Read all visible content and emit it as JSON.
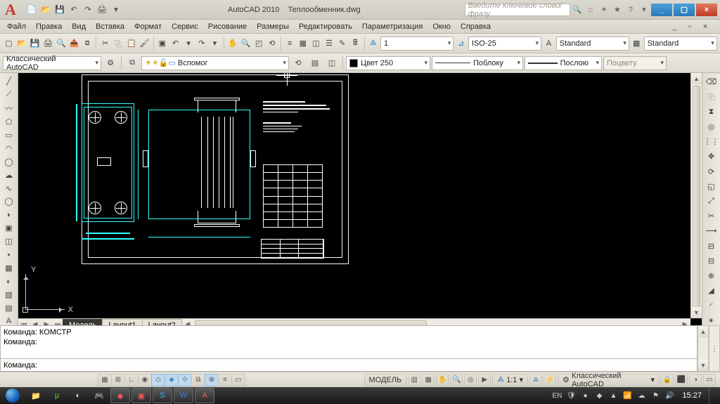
{
  "title": {
    "app": "AutoCAD 2010",
    "file": "Теплообменник.dwg",
    "search_placeholder": "Введите ключевое слово/фразу"
  },
  "menubar": [
    "Файл",
    "Правка",
    "Вид",
    "Вставка",
    "Формат",
    "Сервис",
    "Рисование",
    "Размеры",
    "Редактировать",
    "Параметризация",
    "Окно",
    "Справка"
  ],
  "workspace": {
    "value": "Классический AutoCAD"
  },
  "layer": {
    "value": "Вспомог"
  },
  "tb3": {
    "anno_scale": "1",
    "dim_style": "ISO-25",
    "text_style_1": "Standard",
    "text_style_2": "Standard"
  },
  "tb4": {
    "color": "Цвет 250",
    "linetype": "Поблоку",
    "lineweight": "Послою",
    "plotstyle": "Поцвету"
  },
  "tabs": {
    "model": "Модель",
    "layout1": "Layout1",
    "layout2": "Layout2"
  },
  "ucs": {
    "x": "X",
    "y": "Y"
  },
  "command": {
    "prompt": "Команда:",
    "history_line1": "Команда: КОМСТР",
    "history_line2": "Команда:"
  },
  "statusbar": {
    "model_btn": "МОДЕЛЬ",
    "scale": "1:1",
    "workspace_chip": "Классический AutoCAD",
    "lang": "EN"
  },
  "taskbar": {
    "clock": "15:27"
  }
}
